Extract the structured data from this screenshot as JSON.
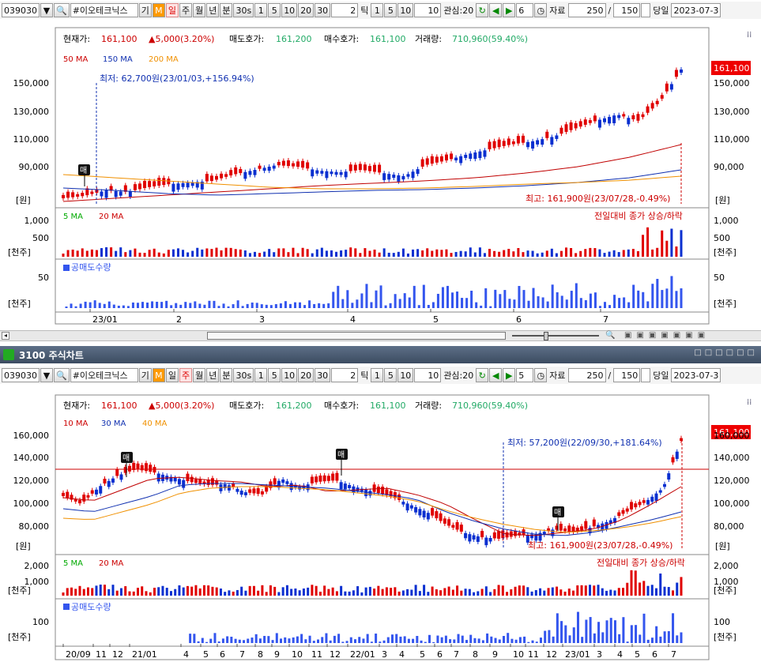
{
  "toolbar": {
    "code": "039030",
    "name": "#이오테크닉스",
    "gi": "기",
    "m": "M",
    "periods": [
      "일",
      "주",
      "월",
      "년",
      "분"
    ],
    "minutes": [
      "30s",
      "1",
      "5",
      "10",
      "20",
      "30"
    ],
    "tick_value": "2",
    "tick_label": "틱",
    "ticks": [
      "1",
      "5",
      "10"
    ],
    "tick_input": "10",
    "interest": "관심:20",
    "count": "6",
    "data_label": "자료",
    "data_count": "250",
    "of": "/",
    "total": "150",
    "today": "당일",
    "date": "2023-07-3"
  },
  "toolbar2": {
    "count": "5"
  },
  "info": {
    "price_label": "현재가:",
    "price": "161,100",
    "change": "▲5,000(3.20%)",
    "ask_label": "매도호가:",
    "ask": "161,200",
    "bid_label": "매수호가:",
    "bid": "161,100",
    "vol_label": "거래량:",
    "vol": "710,960(59.40%)"
  },
  "chart1": {
    "ma": [
      "50 MA",
      "150 MA",
      "200 MA"
    ],
    "yticks": [
      "150,000",
      "130,000",
      "110,000",
      "90,000"
    ],
    "unit": "[원]",
    "last_price": "161,100",
    "low_annot": "최저: 62,700원(23/01/03,+156.94%)",
    "high_annot": "최고: 161,900원(23/07/28,-0.49%)",
    "marker": "매",
    "vol_ma": [
      "5 MA",
      "20 MA"
    ],
    "vol_yticks": [
      "1,000",
      "500"
    ],
    "vol_unit": "[천주]",
    "vol_note": "전일대비 종가 상승/하락",
    "short_label": "공매도수량",
    "short_ytick": "50",
    "short_unit": "[천주]",
    "xticks": [
      "23/01",
      "2",
      "3",
      "4",
      "5",
      "6",
      "7"
    ]
  },
  "panel2_title": "3100 주식차트",
  "chart2": {
    "ma": [
      "10 MA",
      "30 MA",
      "40 MA"
    ],
    "yticks": [
      "160,000",
      "140,000",
      "120,000",
      "100,000",
      "80,000"
    ],
    "unit": "[원]",
    "last_price": "161,100",
    "low_annot": "최저: 57,200원(22/09/30,+181.64%)",
    "high_annot": "최고: 161,900원(23/07/28,-0.49%)",
    "marker": "매",
    "vol_ma": [
      "5 MA",
      "20 MA"
    ],
    "vol_yticks": [
      "2,000",
      "1,000"
    ],
    "vol_unit": "[천주]",
    "vol_note": "전일대비 종가 상승/하락",
    "short_label": "공매도수량",
    "short_ytick": "100",
    "short_unit": "[천주]",
    "xticks": [
      "20/09",
      "11",
      "12",
      "21/01",
      "4",
      "5",
      "6",
      "7",
      "8",
      "9",
      "10",
      "11",
      "12",
      "22/01",
      "3",
      "4",
      "5",
      "6",
      "7",
      "8",
      "9",
      "10",
      "11",
      "12",
      "23/01",
      "3",
      "4",
      "5",
      "6",
      "7"
    ]
  },
  "colors": {
    "up": "#e00000",
    "down": "#0a2fd0",
    "ma_red": "#c00000",
    "ma_blue": "#1030b0",
    "ma_orange": "#f09000",
    "short": "#3355ee"
  }
}
